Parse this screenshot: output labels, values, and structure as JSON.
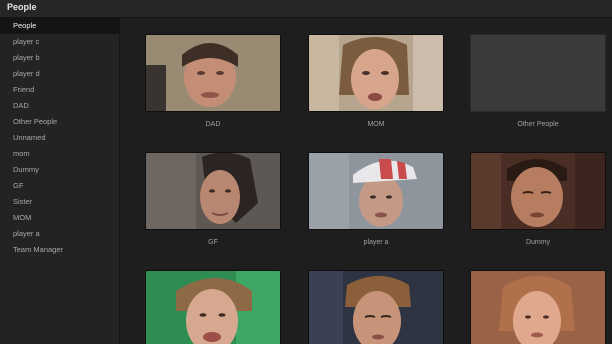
{
  "window": {
    "title": "People"
  },
  "sidebar": {
    "items": [
      {
        "label": "People",
        "selected": true
      },
      {
        "label": "player c"
      },
      {
        "label": "player b"
      },
      {
        "label": "player d"
      },
      {
        "label": "Friend"
      },
      {
        "label": "DAD"
      },
      {
        "label": "Other People"
      },
      {
        "label": "Unnamed"
      },
      {
        "label": "mom"
      },
      {
        "label": "Dummy"
      },
      {
        "label": "GF"
      },
      {
        "label": "Sister"
      },
      {
        "label": "MOM"
      },
      {
        "label": "player a"
      },
      {
        "label": "Team Manager"
      }
    ]
  },
  "grid": {
    "tiles": [
      {
        "caption": "DAD"
      },
      {
        "caption": "MOM"
      },
      {
        "caption": "Other People"
      },
      {
        "caption": "GF"
      },
      {
        "caption": "player a"
      },
      {
        "caption": "Dummy"
      },
      {
        "caption": ""
      },
      {
        "caption": ""
      },
      {
        "caption": ""
      }
    ]
  },
  "colors": {
    "background": "#1f1f1f",
    "sidebar": "#232323",
    "selected": "#141414",
    "empty_thumb": "#3a3a3a"
  }
}
